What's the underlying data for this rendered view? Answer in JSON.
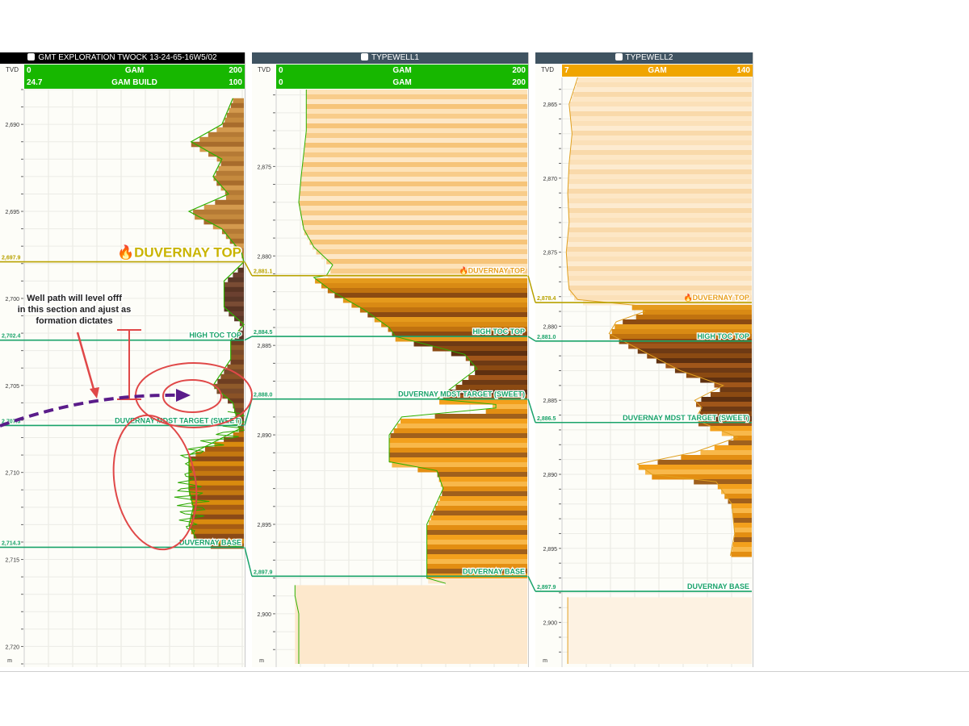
{
  "colors": {
    "header_dark": "#000000",
    "header_slate": "#3f5361",
    "header_green": "#17b700",
    "header_amber": "#f0a500",
    "duvernay_top": "#b8a200",
    "formation": "#1aa36a",
    "green_curve": "#2db000",
    "annotation_red": "#e04848",
    "well_path": "#5a1c8a"
  },
  "track1": {
    "title": "GMT EXPLORATION TWOCK 13-24-65-16W5/02",
    "icon": "well-log-icon",
    "tvd_label": "TVD",
    "unit_label": "m",
    "row1": {
      "left": "0",
      "name": "GAM",
      "right": "200"
    },
    "row2": {
      "left": "24.7",
      "name": "GAM BUILD",
      "right": "100"
    },
    "ticks": [
      "2,690",
      "2,695",
      "2,700",
      "2,705",
      "2,710",
      "2,715",
      "2,720"
    ],
    "tops": [
      {
        "name": "DUVERNAY TOP",
        "depth": "2,697.9"
      },
      {
        "name": "HIGH TOC TOP",
        "depth": "2,702.4"
      },
      {
        "name": "DUVERNAY MDST TARGET (SWEET)",
        "depth": "2,707.3"
      },
      {
        "name": "DUVERNAY BASE",
        "depth": "2,714.3"
      }
    ],
    "note": "Well path will level offf in this section and ajust as formation dictates"
  },
  "track2": {
    "title": "TYPEWELL1",
    "icon": "arrow-down-icon",
    "tvd_label": "TVD",
    "unit_label": "m",
    "row1": {
      "left": "0",
      "name": "GAM",
      "right": "200"
    },
    "row2": {
      "left": "0",
      "name": "GAM",
      "right": "200"
    },
    "ticks": [
      "2,875",
      "2,880",
      "2,885",
      "2,890",
      "2,895",
      "2,900"
    ],
    "tops": [
      {
        "name": "DUVERNAY TOP",
        "depth": "2,881.1"
      },
      {
        "name": "HIGH TOC TOP",
        "depth": "2,884.5"
      },
      {
        "name": "DUVERNAY MDST TARGET (SWEET)",
        "depth": "2,888.0"
      },
      {
        "name": "DUVERNAY BASE",
        "depth": "2,897.9"
      }
    ]
  },
  "track3": {
    "title": "TYPEWELL2",
    "icon": "arrow-down-icon",
    "tvd_label": "TVD",
    "unit_label": "m",
    "row1": {
      "left": "7",
      "name": "GAM",
      "right": "140"
    },
    "ticks": [
      "2,865",
      "2,870",
      "2,875",
      "2,880",
      "2,885",
      "2,890",
      "2,895",
      "2,900"
    ],
    "tops": [
      {
        "name": "DUVERNAY TOP",
        "depth": "2,878.4"
      },
      {
        "name": "HIGH TOC TOP",
        "depth": "2,881.0"
      },
      {
        "name": "DUVERNAY MDST TARGET (SWEET)",
        "depth": "2,886.5"
      },
      {
        "name": "DUVERNAY BASE",
        "depth": "2,897.9"
      }
    ]
  },
  "chart_data": [
    {
      "type": "line",
      "title": "GMT EXPLORATION TWOCK 13-24-65-16W5/02",
      "xlabel": "GAM",
      "ylabel": "TVD",
      "xlim": [
        0,
        200
      ],
      "ylim": [
        2688,
        2721
      ],
      "series": [
        {
          "name": "GAM",
          "x": [
            190,
            180,
            152,
            180,
            172,
            186,
            150,
            180,
            198,
            200,
            182,
            182,
            200,
            188,
            188,
            172,
            190,
            196,
            150,
            150,
            154,
            150,
            158,
            200
          ],
          "y": [
            2688.5,
            2690,
            2691,
            2692,
            2693,
            2694,
            2695,
            2696,
            2697.4,
            2697.9,
            2699,
            2700.5,
            2701.5,
            2702.4,
            2703.5,
            2705,
            2706,
            2707.5,
            2709,
            2711,
            2712,
            2713,
            2714,
            2714.3
          ]
        }
      ],
      "tops": [
        {
          "name": "DUVERNAY TOP",
          "depth": 2697.9
        },
        {
          "name": "HIGH TOC TOP",
          "depth": 2702.4
        },
        {
          "name": "DUVERNAY MDST TARGET (SWEET)",
          "depth": 2707.3
        },
        {
          "name": "DUVERNAY BASE",
          "depth": 2714.3
        }
      ]
    },
    {
      "type": "line",
      "title": "TYPEWELL1",
      "xlabel": "GAM",
      "ylabel": "TVD",
      "xlim": [
        0,
        200
      ],
      "ylim": [
        2870.7,
        2902.8
      ],
      "series": [
        {
          "name": "GAM",
          "x": [
            24,
            24,
            20,
            18,
            22,
            30,
            45,
            40,
            30,
            45,
            70,
            90,
            95,
            150,
            160,
            128,
            175,
            175,
            100,
            90,
            90,
            128,
            133,
            120,
            120,
            135
          ],
          "y": [
            2870.7,
            2873,
            2875.5,
            2877,
            2878.5,
            2879.5,
            2880.5,
            2881.1,
            2881.2,
            2882,
            2883,
            2884,
            2884.5,
            2885.5,
            2886.3,
            2888,
            2888.3,
            2888.5,
            2889,
            2890,
            2891.5,
            2892,
            2893,
            2895,
            2898,
            2898.3
          ]
        },
        {
          "name": "GAM (lower)",
          "x": [
            15,
            15,
            18,
            18
          ],
          "y": [
            2898.4,
            2899,
            2900,
            2902.8
          ]
        }
      ],
      "tops": [
        {
          "name": "DUVERNAY TOP",
          "depth": 2881.1
        },
        {
          "name": "HIGH TOC TOP",
          "depth": 2884.5
        },
        {
          "name": "DUVERNAY MDST TARGET (SWEET)",
          "depth": 2888.0
        },
        {
          "name": "DUVERNAY BASE",
          "depth": 2897.9
        }
      ]
    },
    {
      "type": "line",
      "title": "TYPEWELL2",
      "xlabel": "GAM",
      "ylabel": "TVD",
      "xlim": [
        7,
        140
      ],
      "ylim": [
        2863.2,
        2902.8
      ],
      "series": [
        {
          "name": "GAM",
          "x": [
            18,
            12,
            14,
            12,
            11,
            12,
            10,
            11,
            12,
            18,
            40,
            60,
            65,
            45,
            40,
            50,
            90,
            120,
            100,
            105,
            100,
            130,
            100,
            60,
            70,
            115,
            126,
            128,
            125
          ],
          "y": [
            2863.2,
            2865,
            2867,
            2869,
            2871,
            2873,
            2875,
            2876.5,
            2877.5,
            2878.2,
            2878.4,
            2878.6,
            2879,
            2879.7,
            2880.5,
            2881,
            2883,
            2884,
            2885,
            2885.5,
            2886.3,
            2887.5,
            2888.5,
            2889.3,
            2890,
            2890.5,
            2892,
            2894,
            2895.5
          ]
        },
        {
          "name": "GAM (lower)",
          "x": [
            11,
            11,
            11
          ],
          "y": [
            2898.3,
            2899.5,
            2902.8
          ]
        }
      ],
      "tops": [
        {
          "name": "DUVERNAY TOP",
          "depth": 2878.4
        },
        {
          "name": "HIGH TOC TOP",
          "depth": 2881.0
        },
        {
          "name": "DUVERNAY MDST TARGET (SWEET)",
          "depth": 2886.5
        },
        {
          "name": "DUVERNAY BASE",
          "depth": 2897.9
        }
      ]
    }
  ]
}
